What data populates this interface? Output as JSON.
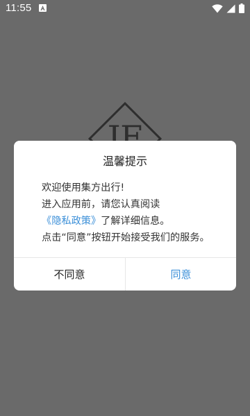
{
  "status_bar": {
    "time": "11:55",
    "icons": [
      "notification-a-icon",
      "wifi-icon",
      "cell-signal-icon",
      "battery-icon"
    ]
  },
  "splash": {
    "logo_text": "JF"
  },
  "dialog": {
    "title": "温馨提示",
    "line1": "欢迎使用集方出行!",
    "line2_prefix": "进入应用前，请您认真阅读",
    "privacy_link": "《隐私政策》",
    "line2_suffix": "了解详细信息。",
    "line3": "点击“同意”按钮开始接受我们的服务。",
    "decline_label": "不同意",
    "accept_label": "同意"
  },
  "colors": {
    "overlay": "#6a6a6a",
    "link": "#3b8fd8",
    "dialog_bg": "#ffffff"
  }
}
